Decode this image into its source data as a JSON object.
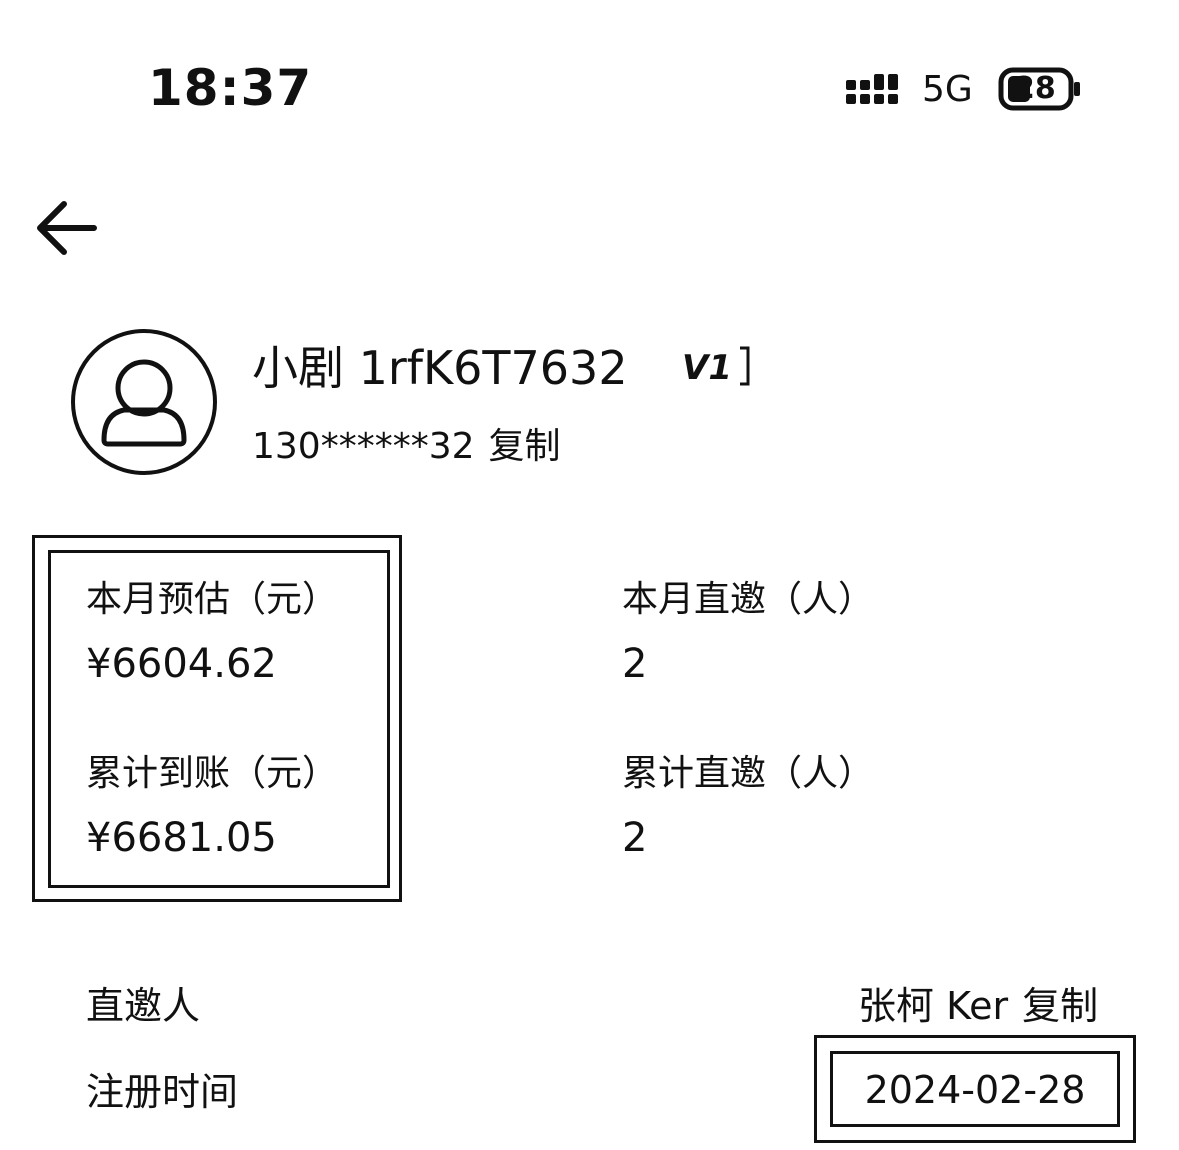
{
  "status_bar": {
    "time": "18:37",
    "network": "5G",
    "battery": "28"
  },
  "header": {
    "back_icon": "arrow-left-icon"
  },
  "profile": {
    "name": "小剧 1rfK6T7632",
    "level": "V1",
    "phone": "130******32",
    "copy_label": "复制",
    "avatar_icon": "user-avatar-icon"
  },
  "stats": {
    "month_estimate_label": "本月预估（元）",
    "month_estimate_value": "¥6604.62",
    "month_invite_label": "本月直邀（人）",
    "month_invite_value": "2",
    "total_received_label": "累计到账（元）",
    "total_received_value": "¥6681.05",
    "total_invite_label": "累计直邀（人）",
    "total_invite_value": "2"
  },
  "info": {
    "inviter_label": "直邀人",
    "inviter_name": "张柯 Ker",
    "inviter_copy_label": "复制",
    "register_label": "注册时间",
    "register_date": "2024-02-28"
  }
}
